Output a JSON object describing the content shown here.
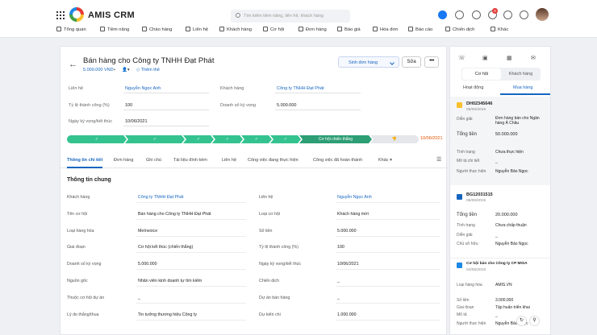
{
  "app": {
    "name": "AMIS CRM",
    "search_placeholder": "Tìm kiếm tiềm năng, liên hệ, khách hàng",
    "notif_count": "9"
  },
  "nav": [
    "Tổng quan",
    "Tiềm năng",
    "Chào hàng",
    "Liên hệ",
    "Khách hàng",
    "Cơ hội",
    "Đơn hàng",
    "Báo giá",
    "Hóa đơn",
    "Báo cáo",
    "Chiến dịch",
    "Khác"
  ],
  "record": {
    "title": "Bán hàng cho Công ty TNHH Đạt Phát",
    "amount": "5.000.000 VND",
    "follow": "Thêm thẻ",
    "gen_label": "Sinh đơn hàng",
    "edit_label": "Sửa",
    "more_label": "•••"
  },
  "head_fields": {
    "contact_label": "Liên hệ",
    "contact": "Nguyễn Ngọc Anh",
    "customer_label": "Khách hàng",
    "customer": "Công ty TNHH Đạt Phát",
    "rate_label": "Tỷ lệ thành công (%)",
    "rate": "100",
    "revenue_label": "Doanh số kỳ vọng",
    "revenue": "5.000.000",
    "date_label": "Ngày kỳ vọng/kết thúc",
    "date": "10/06/2021"
  },
  "stages": {
    "current": "Cơ hội chiến thắng",
    "date": "10/06/2021"
  },
  "tabs": [
    "Thông tin chi tiết",
    "Đơn hàng",
    "Ghi chú",
    "Tài liệu đính kèm",
    "Liên hệ",
    "Công việc đang thực hiện",
    "Công việc đã hoàn thành",
    "Khác"
  ],
  "section": "Thông tin chung",
  "fields_left": [
    {
      "label": "Khách hàng",
      "value": "Công ty TNHH Đạt Phát",
      "link": true
    },
    {
      "label": "Tên cơ hội",
      "value": "Bán hàng cho Công ty TNHH Đạt Phát"
    },
    {
      "label": "Loại hàng hóa",
      "value": "MeInvoice"
    },
    {
      "label": "Giai đoạn",
      "value": "Cơ hội kết thúc (chiến thắng)"
    },
    {
      "label": "Doanh số kỳ vọng",
      "value": "5.000.000"
    },
    {
      "label": "Nguồn gốc",
      "value": "Nhân viên kinh doanh tự tìm kiếm"
    },
    {
      "label": "Thuộc cơ hội dự án",
      "value": "_"
    },
    {
      "label": "Lý do thắng/thua",
      "value": "Tin tưởng thương hiệu Công ty"
    }
  ],
  "fields_right": [
    {
      "label": "Liên hệ",
      "value": "Nguyễn Ngọc Anh",
      "link": true
    },
    {
      "label": "Loại cơ hội",
      "value": "Khách hàng mới"
    },
    {
      "label": "Số tiền",
      "value": "5.000.000"
    },
    {
      "label": "Tỷ lệ thành công (%)",
      "value": "100"
    },
    {
      "label": "Ngày kỳ vọng/kết thúc",
      "value": "10/06/2021"
    },
    {
      "label": "Chiến dịch",
      "value": "_"
    },
    {
      "label": "Dự án bán hàng",
      "value": "_"
    },
    {
      "label": "Dự kiến chi",
      "value": "1.000.000"
    }
  ],
  "side": {
    "seg1": "Cơ hội",
    "seg2": "Khách hàng",
    "tab1": "Hoạt động",
    "tab2": "Mua hàng",
    "cards": [
      {
        "code": "DH02345646",
        "date": "05/06/2019",
        "rows": [
          [
            "Diễn giải",
            "Đơn hàng bán cho Ngân hàng Á Châu"
          ],
          [
            "Tổng tiền",
            "50.000.000"
          ],
          [
            "Tình trạng",
            "Chưa thực hiện"
          ],
          [
            "Mô tả chi tiết",
            "_"
          ],
          [
            "Người thực hiện",
            "Nguyễn Bảo Ngọc"
          ]
        ]
      },
      {
        "code": "BG12031515",
        "date": "05/06/2019",
        "rows": [
          [
            "Tổng tiền",
            "20.000.000"
          ],
          [
            "Tình trạng",
            "Chưa chấp thuận"
          ],
          [
            "Diễn giải",
            "_"
          ],
          [
            "Chủ sở hữu",
            "Nguyễn Bảo Ngọc"
          ]
        ]
      },
      {
        "code": "Cơ hội bán cho Công ty CP MISA",
        "date": "04/06/2019",
        "rows": [
          [
            "Loại hàng hóa",
            "AMIS.VN"
          ],
          [
            "Số tiền",
            "3.000.000"
          ],
          [
            "Giai đoạn",
            "Tập huấn triển khai"
          ],
          [
            "Mô tả",
            "_"
          ],
          [
            "Người thực hiện",
            "Nguyễn Bảo Ngọc"
          ]
        ]
      }
    ]
  }
}
